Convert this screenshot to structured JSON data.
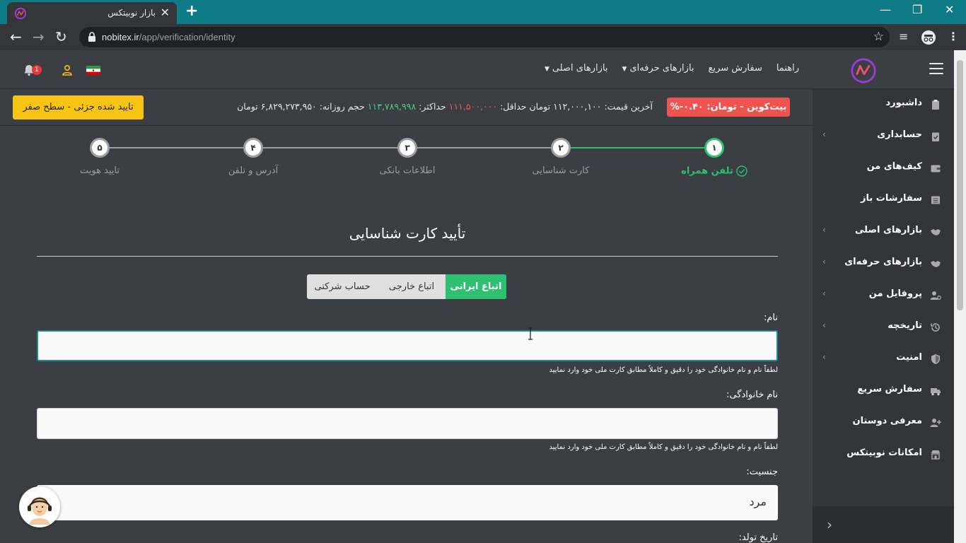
{
  "browser": {
    "tab_title": "بازار نوبیتکس",
    "url_host": "nobitex.ir",
    "url_path": "/app/verification/identity"
  },
  "header": {
    "nav": [
      {
        "label": "بازارهای اصلی",
        "has_caret": true
      },
      {
        "label": "بازارهای حرفه‌ای",
        "has_caret": true
      },
      {
        "label": "سفارش سریع",
        "has_caret": false
      },
      {
        "label": "راهنما",
        "has_caret": false
      }
    ],
    "notification_count": "1"
  },
  "ticker": {
    "coin_badge": "بیت‌کوین - تومان: ۰.۴۰-%",
    "last_price_label": "آخرین قیمت:",
    "last_price": "۱۱۲,۰۰۰,۱۰۰",
    "currency": "تومان",
    "min_label": "حداقل:",
    "min_value": "۱۱۱,۵۰۰,۰۰۰",
    "max_label": "حداکثر:",
    "max_value": "۱۱۳,۷۸۹,۹۹۸",
    "volume_label": "حجم روزانه:",
    "volume_value": "۶,۸۲۹,۲۷۳,۹۵۰",
    "status_button": "تایید شده جزئی - سطح صفر",
    "colors": {
      "down": "#ef5350",
      "up": "#43d17a",
      "status": "#f7c413"
    }
  },
  "stepper": {
    "steps": [
      {
        "number": "۱",
        "label": "تلفن همراه",
        "state": "done"
      },
      {
        "number": "۲",
        "label": "کارت شناسایی",
        "state": "current"
      },
      {
        "number": "۳",
        "label": "اطلاعات بانکی",
        "state": "pending"
      },
      {
        "number": "۴",
        "label": "آدرس و تلفن",
        "state": "pending"
      },
      {
        "number": "۵",
        "label": "تایید هویت",
        "state": "pending"
      }
    ],
    "accent": "#2fbf71"
  },
  "form": {
    "title": "تأیید کارت شناسایی",
    "segments": [
      {
        "label": "اتباع ایرانی",
        "active": true
      },
      {
        "label": "اتباع خارجی",
        "active": false
      },
      {
        "label": "حساب شرکتی",
        "active": false
      }
    ],
    "first_name_label": "نام:",
    "first_name_value": "",
    "hint": "لطفاً نام و نام خانوادگی خود را دقیق و کاملاً مطابق کارت ملی خود وارد نمایید",
    "last_name_label": "نام خانوادگی:",
    "last_name_value": "",
    "gender_label": "جنسیت:",
    "gender_value": "مرد",
    "birthdate_label": "تاریخ تولد:"
  },
  "sidebar": {
    "items": [
      {
        "label": "داشبورد",
        "icon": "clipboard-icon",
        "chevron": false
      },
      {
        "label": "حسابداری",
        "icon": "clipboard-check-icon",
        "chevron": true
      },
      {
        "label": "کیف‌های من",
        "icon": "wallet-icon",
        "chevron": false
      },
      {
        "label": "سفارشات باز",
        "icon": "list-icon",
        "chevron": false
      },
      {
        "label": "بازارهای اصلی",
        "icon": "handshake-icon",
        "chevron": true
      },
      {
        "label": "بازارهای حرفه‌ای",
        "icon": "handshake-icon",
        "chevron": true
      },
      {
        "label": "پروفایل من",
        "icon": "user-gear-icon",
        "chevron": true
      },
      {
        "label": "تاریخچه",
        "icon": "history-icon",
        "chevron": true
      },
      {
        "label": "امنیت",
        "icon": "shield-icon",
        "chevron": true
      },
      {
        "label": "سفارش سریع",
        "icon": "truck-icon",
        "chevron": false
      },
      {
        "label": "معرفی دوستان",
        "icon": "user-plus-icon",
        "chevron": false
      },
      {
        "label": "امکانات نوبیتکس",
        "icon": "store-icon",
        "chevron": false
      }
    ]
  }
}
